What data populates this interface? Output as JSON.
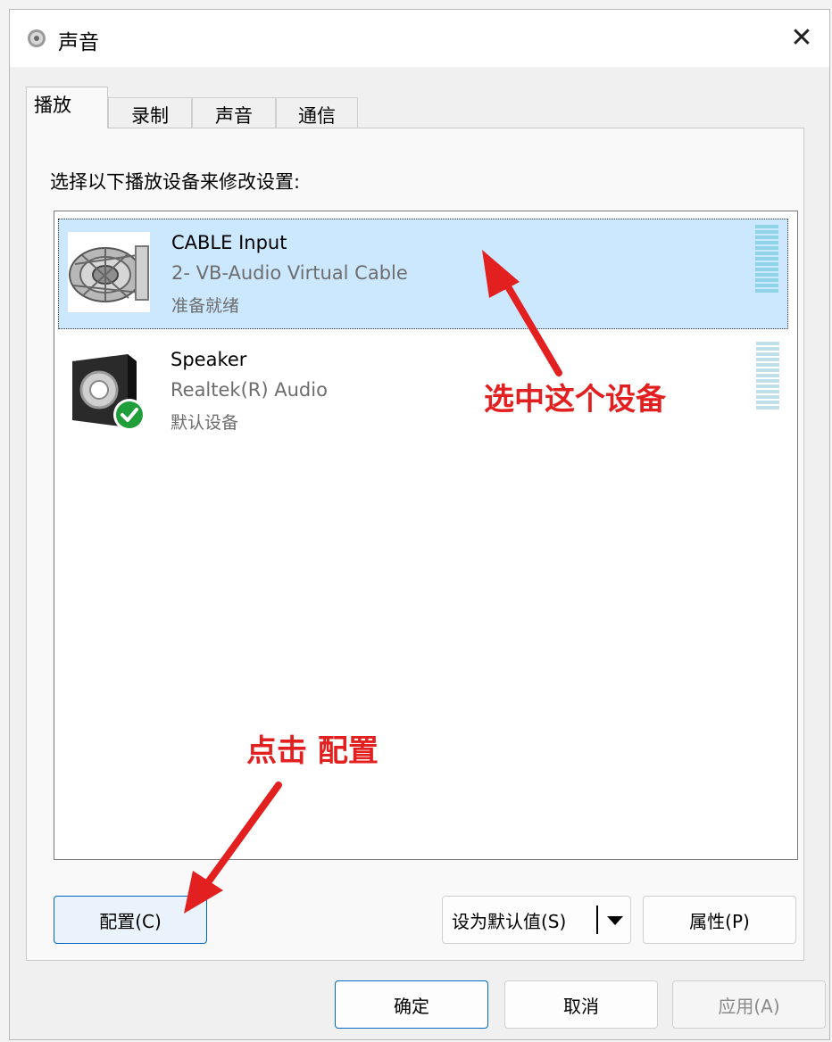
{
  "window": {
    "title": "声音",
    "close_label": "✕"
  },
  "tabs": [
    {
      "label": "播放",
      "active": true
    },
    {
      "label": "录制",
      "active": false
    },
    {
      "label": "声音",
      "active": false
    },
    {
      "label": "通信",
      "active": false
    }
  ],
  "panel": {
    "instruction": "选择以下播放设备来修改设置:"
  },
  "devices": [
    {
      "name": "CABLE Input",
      "description": "2- VB-Audio Virtual Cable",
      "status": "准备就绪",
      "selected": true,
      "icon": "virtual-cable-icon"
    },
    {
      "name": "Speaker",
      "description": "Realtek(R) Audio",
      "status": "默认设备",
      "selected": false,
      "icon": "speaker-icon",
      "default_badge": "check-icon"
    }
  ],
  "buttons": {
    "configure": "配置(C)",
    "set_default": "设为默认值(S)",
    "properties": "属性(P)",
    "ok": "确定",
    "cancel": "取消",
    "apply": "应用(A)"
  },
  "annotations": {
    "select_device": "选中这个设备",
    "click_configure": "点击 配置"
  },
  "colors": {
    "selection": "#cce8ff",
    "accent": "#0067c0",
    "annotation": "#e32020",
    "check": "#1f9e3a"
  }
}
